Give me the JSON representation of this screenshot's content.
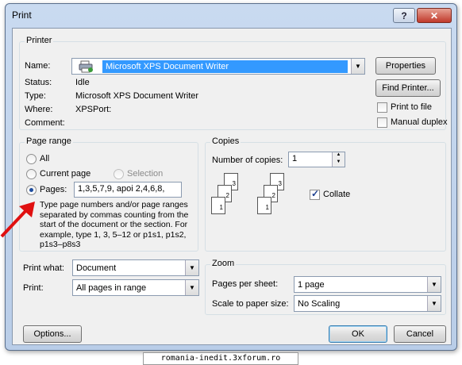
{
  "window": {
    "title": "Print"
  },
  "printer": {
    "group_label": "Printer",
    "name_label": "Name:",
    "name_value": "Microsoft XPS Document Writer",
    "status_label": "Status:",
    "status_value": "Idle",
    "type_label": "Type:",
    "type_value": "Microsoft XPS Document Writer",
    "where_label": "Where:",
    "where_value": "XPSPort:",
    "comment_label": "Comment:",
    "properties_label": "Properties",
    "find_printer_label": "Find Printer...",
    "print_to_file_label": "Print to file",
    "manual_duplex_label": "Manual duplex"
  },
  "page_range": {
    "group_label": "Page range",
    "all_label": "All",
    "current_page_label": "Current page",
    "selection_label": "Selection",
    "pages_label": "Pages:",
    "pages_value": "1,3,5,7,9,  apoi 2,4,6,8,",
    "help_text": "Type page numbers and/or page ranges separated by commas counting from the start of the document or the section. For example, type 1, 3, 5–12 or p1s1, p1s2, p1s3–p8s3",
    "selected": "pages"
  },
  "copies": {
    "group_label": "Copies",
    "number_label": "Number of copies:",
    "number_value": "1",
    "collate_label": "Collate",
    "collate_checked": true,
    "stack_numbers": [
      "3",
      "2",
      "1"
    ]
  },
  "print_what": {
    "label": "Print what:",
    "value": "Document"
  },
  "print": {
    "label": "Print:",
    "value": "All pages in range"
  },
  "zoom": {
    "group_label": "Zoom",
    "pages_per_sheet_label": "Pages per sheet:",
    "pages_per_sheet_value": "1 page",
    "scale_label": "Scale to paper size:",
    "scale_value": "No Scaling"
  },
  "footer": {
    "options_label": "Options...",
    "ok_label": "OK",
    "cancel_label": "Cancel"
  },
  "watermark": "romania-inedit.3xforum.ro",
  "colors": {
    "selection": "#3399ff",
    "annotation_arrow": "#e01010"
  }
}
